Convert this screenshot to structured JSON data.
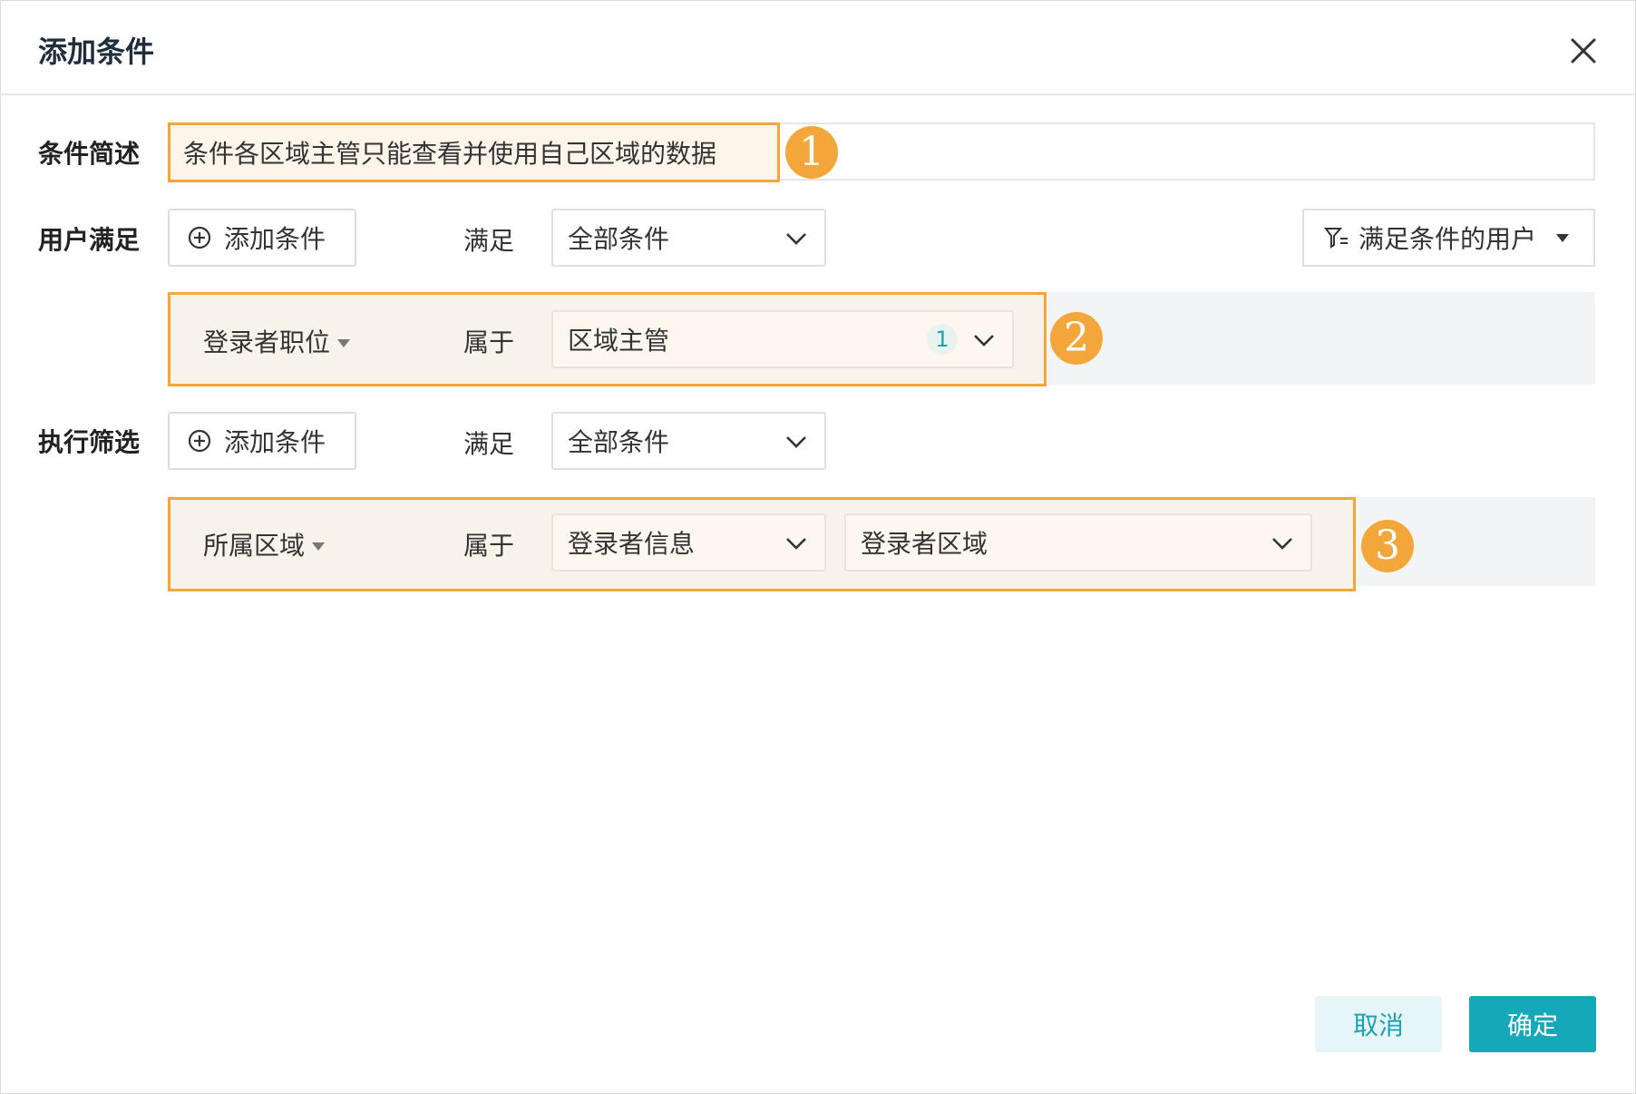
{
  "dialog": {
    "title": "添加条件",
    "close_icon": "close-icon"
  },
  "description": {
    "label": "条件简述",
    "value": "条件各区域主管只能查看并使用自己区域的数据",
    "marker": "1"
  },
  "user_section": {
    "label": "用户满足",
    "add_button": "添加条件",
    "match_label": "满足",
    "match_value": "全部条件",
    "filter_button": "满足条件的用户",
    "condition": {
      "field": "登录者职位",
      "operator": "属于",
      "value": "区域主管",
      "count": "1",
      "marker": "2"
    }
  },
  "filter_section": {
    "label": "执行筛选",
    "add_button": "添加条件",
    "match_label": "满足",
    "match_value": "全部条件",
    "condition": {
      "field": "所属区域",
      "operator": "属于",
      "value_type": "登录者信息",
      "value": "登录者区域",
      "marker": "3"
    }
  },
  "footer": {
    "cancel": "取消",
    "ok": "确定"
  },
  "colors": {
    "accent_orange": "#f3a73b",
    "primary_teal": "#14a8b8"
  }
}
